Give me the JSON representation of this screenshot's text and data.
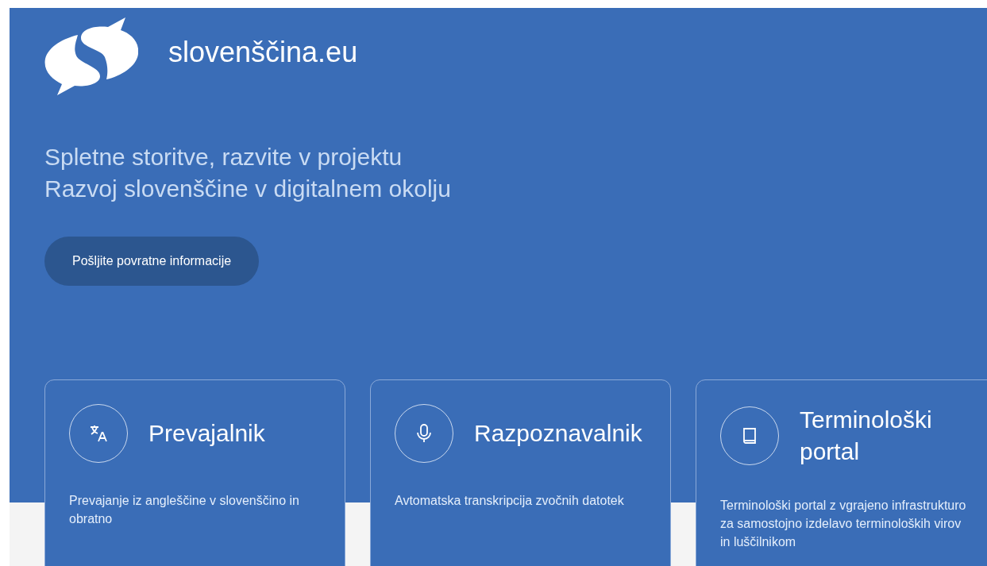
{
  "brand": {
    "name": "slovenščina.eu"
  },
  "hero": {
    "heading_lines": [
      "Spletne storitve, razvite v projektu",
      "Razvoj slovenščine v digitalnem okolju"
    ],
    "button": "Pošljite povratne informacije"
  },
  "cards": [
    {
      "kind": "translate",
      "title": "Prevajalnik",
      "description": "Prevajanje iz angleščine v slovenščino in obratno"
    },
    {
      "kind": "microphone",
      "title": "Razpoznavalnik",
      "description": "Avtomatska transkripcija zvočnih datotek"
    },
    {
      "kind": "book",
      "title": "Terminološki portal",
      "description": "Terminološki portal z vgrajeno infrastrukturo za samostojno izdelavo terminoloških virov in luščilnikom"
    }
  ]
}
